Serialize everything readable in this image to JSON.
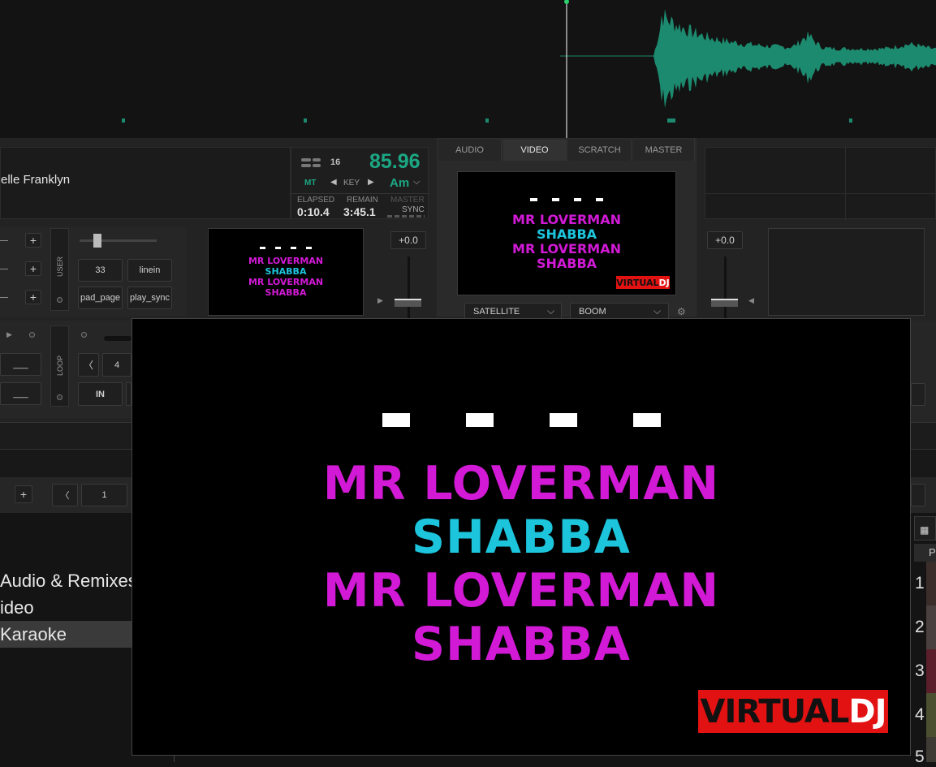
{
  "deck_left": {
    "artist_partial": "elle Franklyn",
    "bpm": "85.96",
    "beats": "16",
    "mt_label": "MT",
    "key_label": "KEY",
    "key_value": "Am",
    "elapsed_label": "ELAPSED",
    "elapsed_value": "0:10.4",
    "remain_label": "REMAIN",
    "remain_value": "3:45.1",
    "master_label": "MASTER",
    "sync_label": "SYNC",
    "pitch_value": "+0.0",
    "user_label": "USER",
    "loop_label": "LOOP",
    "pad_values": [
      "33",
      "linein",
      "pad_page",
      "play_sync"
    ],
    "loop_size": "4",
    "in_label": "IN",
    "page_number": "1"
  },
  "deck_right": {
    "pitch_value": "+0.0"
  },
  "center_tabs": [
    {
      "label": "AUDIO",
      "active": false
    },
    {
      "label": "VIDEO",
      "active": true
    },
    {
      "label": "SCRATCH",
      "active": false
    },
    {
      "label": "MASTER",
      "active": false
    }
  ],
  "video": {
    "dashes": "- - - -",
    "lines": [
      {
        "text": "MR LOVERMAN",
        "color": "#d21ad6"
      },
      {
        "text": "SHABBA",
        "color": "#1cc5dc"
      },
      {
        "text": "MR LOVERMAN",
        "color": "#d21ad6"
      },
      {
        "text": "SHABBA",
        "color": "#d21ad6"
      }
    ],
    "logo_left": "VIRTUAL",
    "logo_right": "DJ"
  },
  "center_controls": {
    "effect_left": "SATELLITE",
    "effect_right": "BOOM"
  },
  "browser": {
    "folders": [
      {
        "label": "Audio & Remixes",
        "selected": false
      },
      {
        "label": "ideo",
        "selected": false
      },
      {
        "label": "Karaoke",
        "selected": true
      }
    ],
    "row_numbers": [
      "1",
      "2",
      "3",
      "4",
      "5"
    ],
    "column_header_partial": "P"
  },
  "colors": {
    "waveform": "#1c8a6e",
    "bpm": "#1ca784",
    "magenta": "#d21ad6",
    "cyan": "#1cc5dc",
    "logo_red": "#e31212"
  }
}
